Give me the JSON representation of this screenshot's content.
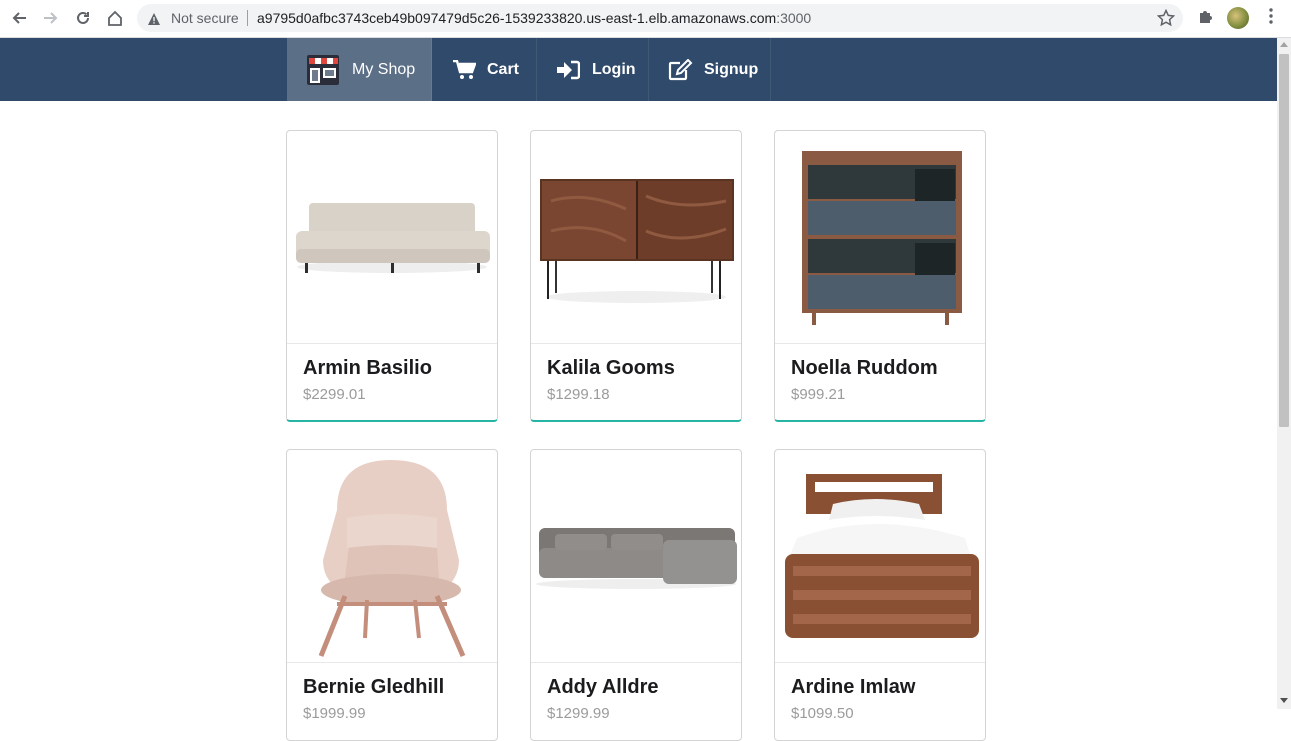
{
  "browser": {
    "security_label": "Not secure",
    "url_host": "a9795d0afbc3743ceb49b097479d5c26-1539233820.us-east-1.elb.amazonaws.com",
    "url_port": ":3000"
  },
  "nav": {
    "items": [
      {
        "label": "My Shop",
        "icon": "shop-icon"
      },
      {
        "label": "Cart",
        "icon": "cart-icon"
      },
      {
        "label": "Login",
        "icon": "login-icon"
      },
      {
        "label": "Signup",
        "icon": "edit-icon"
      }
    ]
  },
  "products": [
    {
      "name": "Armin Basilio",
      "price": "$2299.01",
      "image": "sofa"
    },
    {
      "name": "Kalila Gooms",
      "price": "$1299.18",
      "image": "walnut-credenza"
    },
    {
      "name": "Noella Ruddom",
      "price": "$999.21",
      "image": "drawer-cabinet"
    },
    {
      "name": "Bernie Gledhill",
      "price": "$1999.99",
      "image": "lounge-chair"
    },
    {
      "name": "Addy Alldre",
      "price": "$1299.99",
      "image": "sectional-sofa"
    },
    {
      "name": "Ardine Imlaw",
      "price": "$1099.50",
      "image": "wood-bed"
    }
  ],
  "colors": {
    "nav_bg": "#2f4a6a",
    "nav_active": "#5b6f87",
    "accent": "#26b5a5"
  }
}
